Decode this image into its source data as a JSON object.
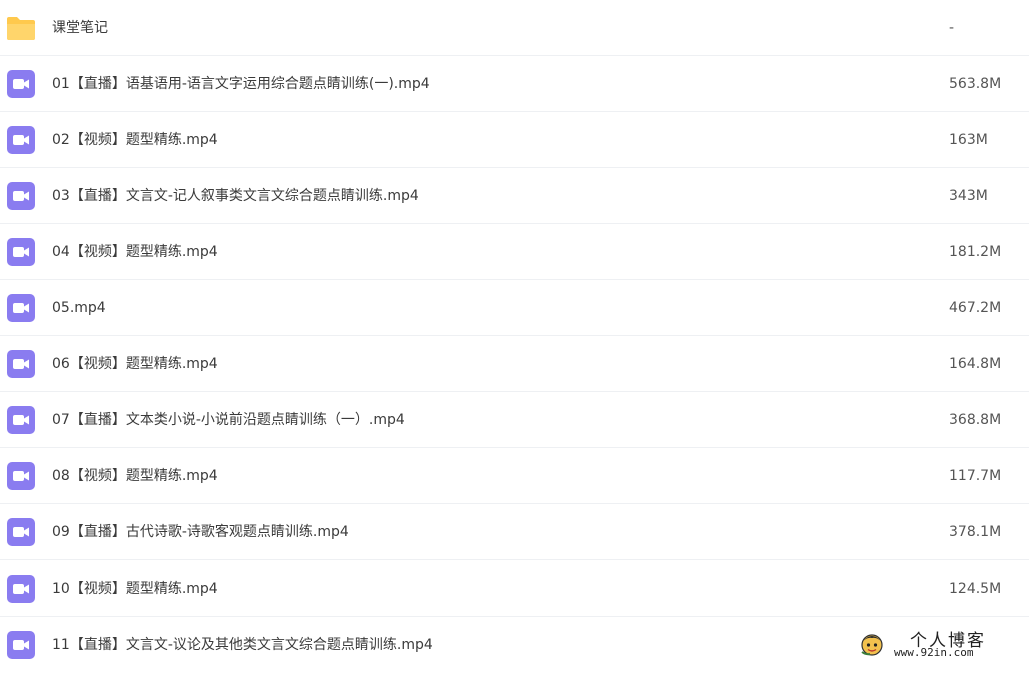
{
  "files": [
    {
      "name": "课堂笔记",
      "size": "-",
      "icon": "folder-icon"
    },
    {
      "name": "01【直播】语基语用-语言文字运用综合题点睛训练(一).mp4",
      "size": "563.8M",
      "icon": "video-file-icon"
    },
    {
      "name": "02【视频】题型精练.mp4",
      "size": "163M",
      "icon": "video-file-icon"
    },
    {
      "name": "03【直播】文言文-记人叙事类文言文综合题点睛训练.mp4",
      "size": "343M",
      "icon": "video-file-icon"
    },
    {
      "name": "04【视频】题型精练.mp4",
      "size": "181.2M",
      "icon": "video-file-icon"
    },
    {
      "name": "05.mp4",
      "size": "467.2M",
      "icon": "video-file-icon"
    },
    {
      "name": "06【视频】题型精练.mp4",
      "size": "164.8M",
      "icon": "video-file-icon"
    },
    {
      "name": "07【直播】文本类小说-小说前沿题点睛训练（一）.mp4",
      "size": "368.8M",
      "icon": "video-file-icon"
    },
    {
      "name": "08【视频】题型精练.mp4",
      "size": "117.7M",
      "icon": "video-file-icon"
    },
    {
      "name": "09【直播】古代诗歌-诗歌客观题点睛训练.mp4",
      "size": "378.1M",
      "icon": "video-file-icon"
    },
    {
      "name": "10【视频】题型精练.mp4",
      "size": "124.5M",
      "icon": "video-file-icon"
    },
    {
      "name": "11【直播】文言文-议论及其他类文言文综合题点睛训练.mp4",
      "size": "",
      "icon": "video-file-icon"
    }
  ],
  "watermark": {
    "title": "个人博客",
    "url": "www.92in.com"
  },
  "colors": {
    "folder": "#ffc94d",
    "video": "#8a7cf0",
    "divider": "#eef0f3"
  }
}
